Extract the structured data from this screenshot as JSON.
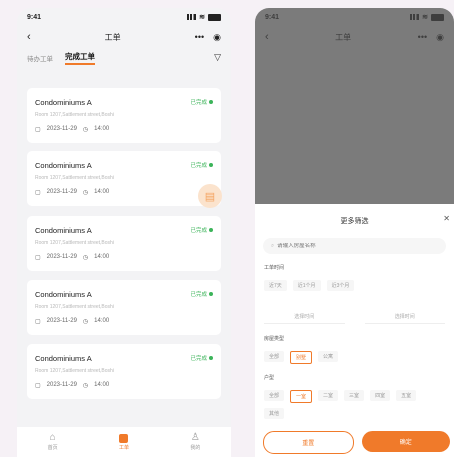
{
  "time": "9:41",
  "left_screen": {
    "nav": {
      "title": "工单"
    },
    "tabs": [
      "待办工单",
      "完成工单"
    ],
    "orders": [
      {
        "title": "Condominiums A",
        "status": "已完成",
        "address": "Room 1207,Sattlement street,Boshi",
        "date": "2023-11-29",
        "time": "14:00"
      },
      {
        "title": "Condominiums A",
        "status": "已完成",
        "address": "Room 1207,Sattlement street,Boshi",
        "date": "2023-11-29",
        "time": "14:00"
      },
      {
        "title": "Condominiums A",
        "status": "已完成",
        "address": "Room 1207,Sattlement street,Boshi",
        "date": "2023-11-29",
        "time": "14:00"
      },
      {
        "title": "Condominiums A",
        "status": "已完成",
        "address": "Room 1207,Sattlement street,Boshi",
        "date": "2023-11-29",
        "time": "14:00"
      },
      {
        "title": "Condominiums A",
        "status": "已完成",
        "address": "Room 1207,Sattlement street,Boshi",
        "date": "2023-11-29",
        "time": "14:00"
      }
    ],
    "tabbar": [
      "首页",
      "工单",
      "我的"
    ]
  },
  "right_screen": {
    "nav": {
      "title": "工单"
    },
    "sheet": {
      "title": "更多筛选",
      "search_placeholder": "请输入房屋名称",
      "time_label": "工单时间",
      "time_options": [
        "近7天",
        "近1个月",
        "近3个月"
      ],
      "start_placeholder": "选择时间",
      "end_placeholder": "选择时间",
      "house_type_label": "房屋类型",
      "house_types": [
        "全部",
        "别墅",
        "公寓"
      ],
      "layout_label": "户型",
      "layouts": [
        "全部",
        "一室",
        "二室",
        "三室",
        "四室",
        "五室",
        "其他"
      ],
      "reset": "重置",
      "confirm": "确定"
    }
  },
  "accent_color": "#f07a2a",
  "status_color": "#3cb45a"
}
